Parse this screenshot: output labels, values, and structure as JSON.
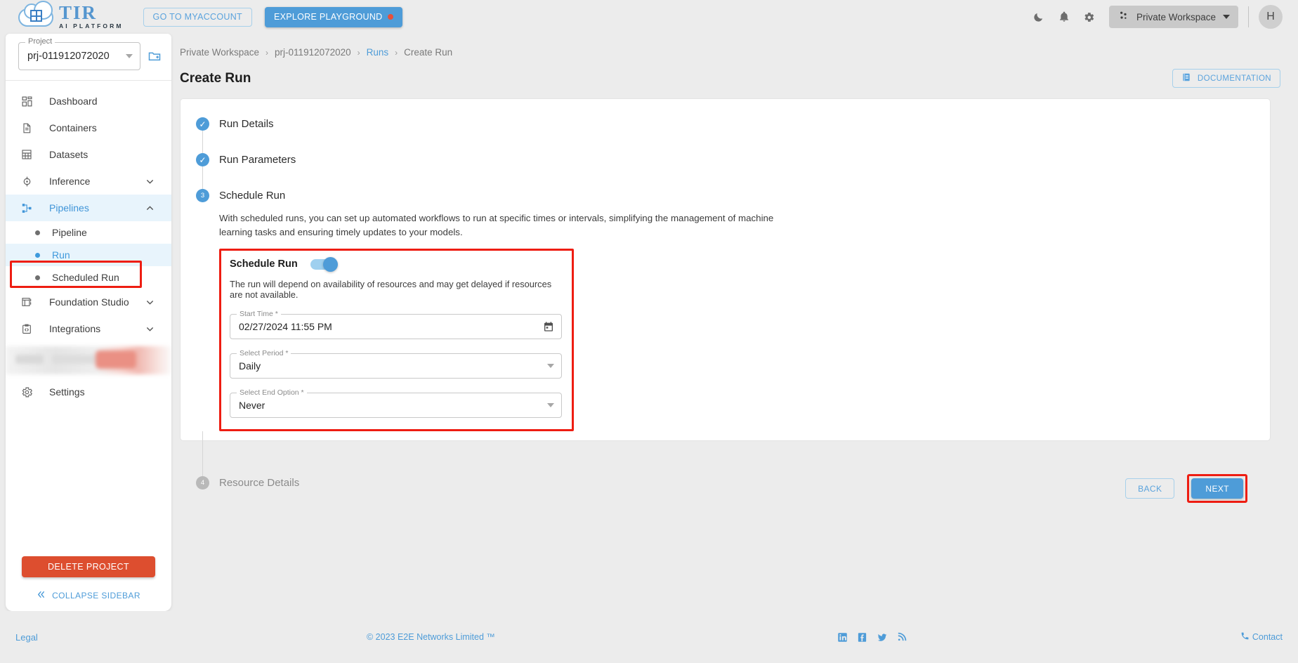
{
  "header": {
    "logo": {
      "brand": "TIR",
      "tagline": "AI PLATFORM",
      "icon": "cloud-grid-logo-icon"
    },
    "myaccount_label": "GO TO MYACCOUNT",
    "playground_label": "EXPLORE PLAYGROUND",
    "icons": [
      "dark-mode-icon",
      "notifications-icon",
      "settings-icon"
    ],
    "workspace": {
      "label": "Private Workspace",
      "icon": "workspace-nodes-icon"
    },
    "avatar_initial": "H"
  },
  "sidebar": {
    "project": {
      "legend": "Project",
      "value": "prj-011912072020"
    },
    "new_project_icon": "new-folder-icon",
    "items": [
      {
        "label": "Dashboard",
        "icon": "dashboard-icon",
        "type": "item"
      },
      {
        "label": "Containers",
        "icon": "document-icon",
        "type": "item"
      },
      {
        "label": "Datasets",
        "icon": "grid-table-icon",
        "type": "item"
      },
      {
        "label": "Inference",
        "icon": "inference-icon",
        "type": "expandable",
        "expanded": false
      },
      {
        "label": "Pipelines",
        "icon": "pipelines-icon",
        "type": "expandable",
        "expanded": true,
        "active": true
      },
      {
        "label": "Pipeline",
        "type": "sub"
      },
      {
        "label": "Run",
        "type": "sub",
        "selected": true,
        "highlighted": true
      },
      {
        "label": "Scheduled Run",
        "type": "sub"
      },
      {
        "label": "Foundation Studio",
        "icon": "foundation-studio-icon",
        "type": "expandable",
        "expanded": false
      },
      {
        "label": "Integrations",
        "icon": "integrations-code-icon",
        "type": "expandable",
        "expanded": false
      },
      {
        "label": "",
        "type": "redacted"
      },
      {
        "label": "Settings",
        "icon": "gear-icon",
        "type": "item"
      }
    ],
    "delete_project_label": "DELETE PROJECT",
    "collapse_label": "COLLAPSE SIDEBAR"
  },
  "main": {
    "breadcrumb": [
      {
        "label": "Private Workspace",
        "link": false
      },
      {
        "label": "prj-011912072020",
        "link": false
      },
      {
        "label": "Runs",
        "link": true
      },
      {
        "label": "Create Run",
        "link": false
      }
    ],
    "page_title": "Create Run",
    "documentation_label": "DOCUMENTATION",
    "steps": [
      {
        "number": "1",
        "label": "Run Details",
        "state": "done"
      },
      {
        "number": "2",
        "label": "Run Parameters",
        "state": "done"
      },
      {
        "number": "3",
        "label": "Schedule Run",
        "state": "active"
      },
      {
        "number": "4",
        "label": "Resource Details",
        "state": "pending"
      }
    ],
    "schedule": {
      "description": "With scheduled runs, you can set up automated workflows to run at specific times or intervals, simplifying the management of machine learning tasks and ensuring timely updates to your models.",
      "panel_title": "Schedule Run",
      "toggle_on": true,
      "note": "The run will depend on availability of resources and may get delayed if resources are not available.",
      "fields": [
        {
          "legend": "Start Time *",
          "value": "02/27/2024 11:55 PM",
          "control": "datetime",
          "icon": "calendar-icon"
        },
        {
          "legend": "Select Period *",
          "value": "Daily",
          "control": "select"
        },
        {
          "legend": "Select End Option *",
          "value": "Never",
          "control": "select"
        }
      ]
    },
    "back_label": "BACK",
    "next_label": "NEXT"
  },
  "footer": {
    "legal": "Legal",
    "copyright": "© 2023 E2E Networks Limited ™",
    "social": [
      "linkedin-icon",
      "facebook-icon",
      "twitter-icon",
      "rss-icon"
    ],
    "contact": "Contact",
    "contact_icon": "phone-icon"
  },
  "colors": {
    "accent": "#4e9cd8",
    "highlight": "#ee1d12",
    "danger": "#dd4e2f",
    "bg": "#ececec"
  }
}
